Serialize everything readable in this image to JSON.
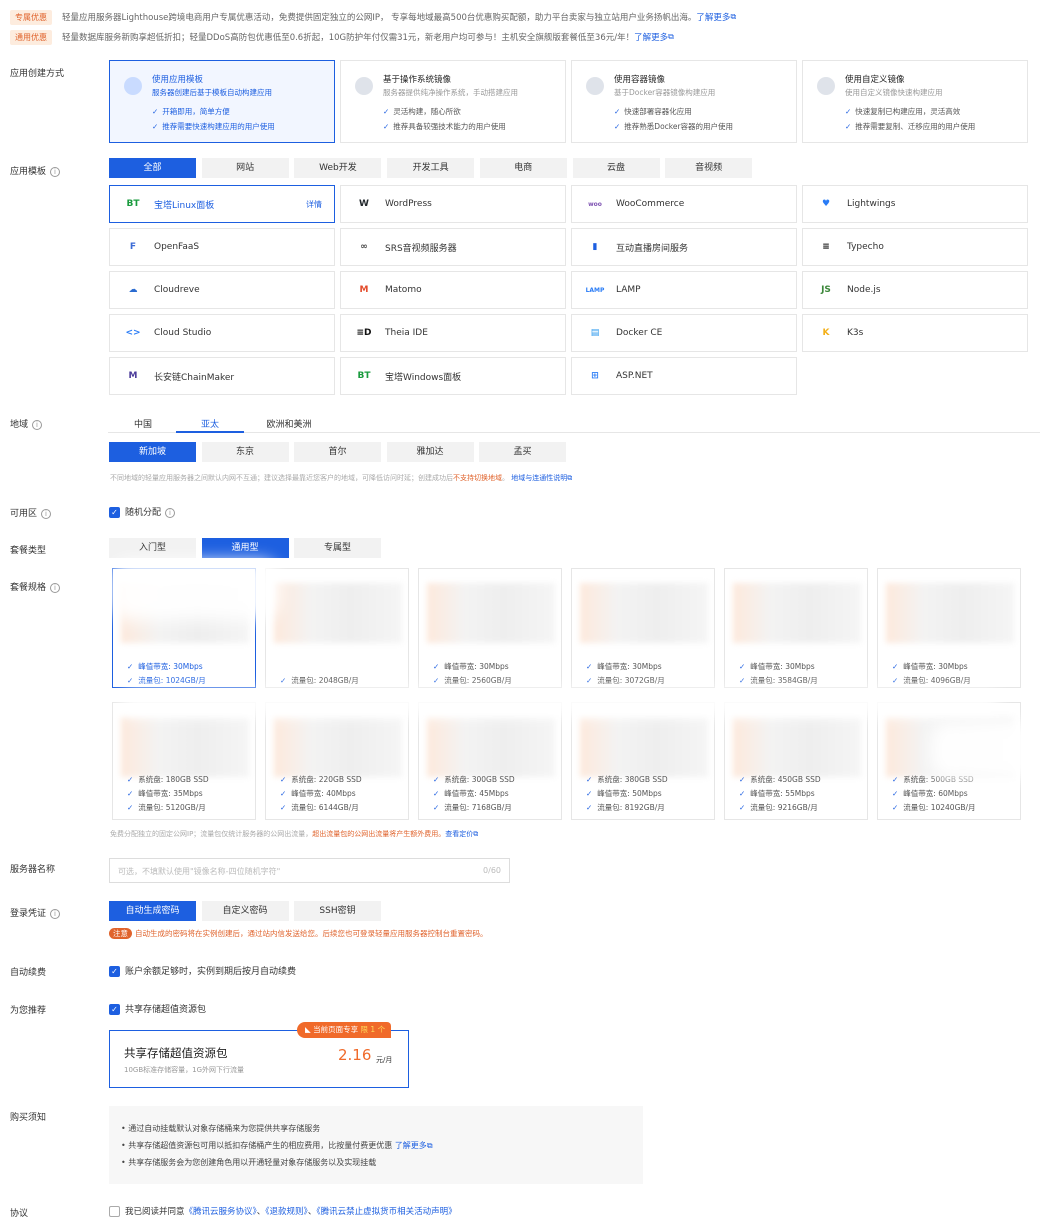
{
  "promos": [
    {
      "tag": "专属优惠",
      "text": "轻量应用服务器Lighthouse跨境电商用户专属优惠活动，免费提供固定独立的公网IP， 专享每地域最高500台优惠购买配额，助力平台卖家与独立站用户业务扬帆出海。",
      "link": "了解更多"
    },
    {
      "tag": "通用优惠",
      "text": "轻量数据库服务新购享超低折扣；轻量DDoS高防包优惠低至0.6折起，10G防护年付仅需31元，新老用户均可参与！主机安全旗舰版套餐低至36元/年！",
      "link": "了解更多"
    }
  ],
  "labels": {
    "create_mode": "应用创建方式",
    "app_template": "应用模板",
    "region": "地域",
    "zone": "可用区",
    "plan_type": "套餐类型",
    "plan_spec": "套餐规格",
    "server_name": "服务器名称",
    "login": "登录凭证",
    "auto_renew": "自动续费",
    "recommend": "为您推荐",
    "notice": "购买须知",
    "agreement": "协议"
  },
  "create_modes": [
    {
      "title": "使用应用模板",
      "sub": "服务器创建后基于模板自动构建应用",
      "checks": [
        "开箱即用，简单方便",
        "推荐需要快速构建应用的用户使用"
      ]
    },
    {
      "title": "基于操作系统镜像",
      "sub": "服务器提供纯净操作系统，手动搭建应用",
      "checks": [
        "灵活构建，随心所欲",
        "推荐具备较强技术能力的用户使用"
      ]
    },
    {
      "title": "使用容器镜像",
      "sub": "基于Docker容器镜像构建应用",
      "checks": [
        "快速部署容器化应用",
        "推荐熟悉Docker容器的用户使用"
      ]
    },
    {
      "title": "使用自定义镜像",
      "sub": "使用自定义镜像快速构建应用",
      "checks": [
        "快速复制已构建应用，灵活高效",
        "推荐需要复制、迁移应用的用户使用"
      ]
    }
  ],
  "template_tabs": [
    "全部",
    "网站",
    "Web开发",
    "开发工具",
    "电商",
    "云盘",
    "音视频"
  ],
  "apps": [
    {
      "name": "宝塔Linux面板",
      "icon": "BT",
      "detail": "详情"
    },
    {
      "name": "WordPress",
      "icon": "W"
    },
    {
      "name": "WooCommerce",
      "icon": "woo"
    },
    {
      "name": "Lightwings",
      "icon": "♥"
    },
    {
      "name": "OpenFaaS",
      "icon": "F"
    },
    {
      "name": "SRS音视频服务器",
      "icon": "∞"
    },
    {
      "name": "互动直播房间服务",
      "icon": "▮"
    },
    {
      "name": "Typecho",
      "icon": "≡"
    },
    {
      "name": "Cloudreve",
      "icon": "☁"
    },
    {
      "name": "Matomo",
      "icon": "M"
    },
    {
      "name": "LAMP",
      "icon": "LAMP"
    },
    {
      "name": "Node.js",
      "icon": "JS"
    },
    {
      "name": "Cloud Studio",
      "icon": "<>"
    },
    {
      "name": "Theia IDE",
      "icon": "≡D"
    },
    {
      "name": "Docker CE",
      "icon": "▤"
    },
    {
      "name": "K3s",
      "icon": "K"
    },
    {
      "name": "长安链ChainMaker",
      "icon": "M"
    },
    {
      "name": "宝塔Windows面板",
      "icon": "BT"
    },
    {
      "name": "ASP.NET",
      "icon": "⊞"
    }
  ],
  "region_tabs": [
    "中国",
    "亚太",
    "欧洲和美洲"
  ],
  "cities": [
    "新加坡",
    "东京",
    "首尔",
    "雅加达",
    "孟买"
  ],
  "region_note": {
    "a": "不同地域的轻量应用服务器之间默认内网不互通；建议选择最靠近您客户的地域，可降低访问时延；创建成功后",
    "b": "不支持切换地域",
    "c": "。",
    "link": "地域与连通性说明"
  },
  "zone_text": "随机分配",
  "plan_types": [
    "入门型",
    "通用型",
    "专属型"
  ],
  "plans_row1": [
    {
      "bw": "峰值带宽: 30Mbps",
      "traffic": "流量包: 1024GB/月"
    },
    {
      "bw": "",
      "traffic": "流量包: 2048GB/月"
    },
    {
      "bw": "峰值带宽: 30Mbps",
      "traffic": "流量包: 2560GB/月"
    },
    {
      "bw": "峰值带宽: 30Mbps",
      "traffic": "流量包: 3072GB/月"
    },
    {
      "bw": "峰值带宽: 30Mbps",
      "traffic": "流量包: 3584GB/月"
    },
    {
      "bw": "峰值带宽: 30Mbps",
      "traffic": "流量包: 4096GB/月"
    }
  ],
  "plans_row2": [
    {
      "disk": "系统盘: 180GB SSD",
      "bw": "峰值带宽: 35Mbps",
      "traffic": "流量包: 5120GB/月"
    },
    {
      "disk": "系统盘: 220GB SSD",
      "bw": "峰值带宽: 40Mbps",
      "traffic": "流量包: 6144GB/月"
    },
    {
      "disk": "系统盘: 300GB SSD",
      "bw": "峰值带宽: 45Mbps",
      "traffic": "流量包: 7168GB/月"
    },
    {
      "disk": "系统盘: 380GB SSD",
      "bw": "峰值带宽: 50Mbps",
      "traffic": "流量包: 8192GB/月"
    },
    {
      "disk": "系统盘: 450GB SSD",
      "bw": "峰值带宽: 55Mbps",
      "traffic": "流量包: 9216GB/月"
    },
    {
      "disk": "系统盘: 500GB SSD",
      "bw": "峰值带宽: 60Mbps",
      "traffic": "流量包: 10240GB/月"
    }
  ],
  "plan_note": {
    "a": "免费分配独立的固定公网IP；流量包仅统计服务器的公网出流量，",
    "b": "超出流量包的公网出流量将产生额外费用。",
    "link": "查看定价"
  },
  "server_name": {
    "placeholder": "可选，不填默认使用\"镜像名称-四位随机字符\"",
    "count": "0/60"
  },
  "login_tabs": [
    "自动生成密码",
    "自定义密码",
    "SSH密钥"
  ],
  "login_note": {
    "tag": "注意",
    "text": "自动生成的密码将在实例创建后，通过站内信发送给您。后续您也可登录轻量应用服务器控制台重置密码。"
  },
  "auto_renew_text": "账户余额足够时，实例到期后按月自动续费",
  "recommend_text": "共享存储超值资源包",
  "storage_card": {
    "badge": "当前页面专享",
    "badge_limit": "限 1 个",
    "title": "共享存储超值资源包",
    "sub": "10GB标准存储容量，1G外网下行流量",
    "price": "2.16",
    "unit": "元/月"
  },
  "notices": [
    "通过自动挂载默认对象存储桶来为您提供共享存储服务",
    "共享存储超值资源包可用以抵扣存储桶产生的相应费用，比按量付费更优惠",
    "共享存储服务会为您创建角色用以开通轻量对象存储服务以及实现挂载"
  ],
  "notice_link": "了解更多",
  "agreement": {
    "a": "我已阅读并同意",
    "b": "《腾讯云服务协议》",
    "c": "、",
    "d": "《退款规则》",
    "e": "、",
    "f": "《腾讯云禁止虚拟货币相关活动声明》"
  }
}
